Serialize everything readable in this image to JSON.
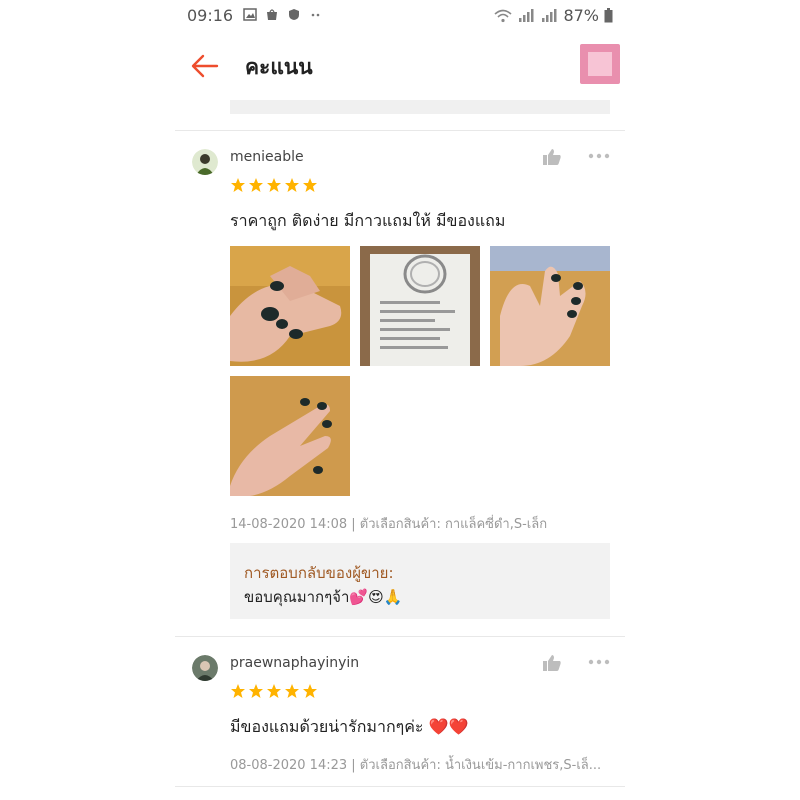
{
  "status_bar": {
    "time": "09:16",
    "battery": "87%"
  },
  "header": {
    "title": "คะแนน"
  },
  "reviews": [
    {
      "username": "menieable",
      "rating": 5,
      "text": "ราคาถูก ติดง่าย มีกาวแถมให้ มีของแถม",
      "meta": "14-08-2020 14:08 | ตัวเลือกสินค้า: กาแล็คซี่ดำ,S-เล็ก",
      "seller_reply": {
        "label": "การตอบกลับของผู้ขาย:",
        "text": "ขอบคุณมากๆจ้า💕😍🙏"
      }
    },
    {
      "username": "praewnaphayinyin",
      "rating": 5,
      "text": "มีของแถมด้วยน่ารักมากๆค่ะ ❤️❤️",
      "meta": "08-08-2020 14:23 | ตัวเลือกสินค้า: น้ำเงินเข้ม-กากเพชร,S-เล็..."
    }
  ],
  "colors": {
    "accent": "#ee4d2d",
    "star": "#ffb300",
    "reply_label": "#a05a24"
  }
}
